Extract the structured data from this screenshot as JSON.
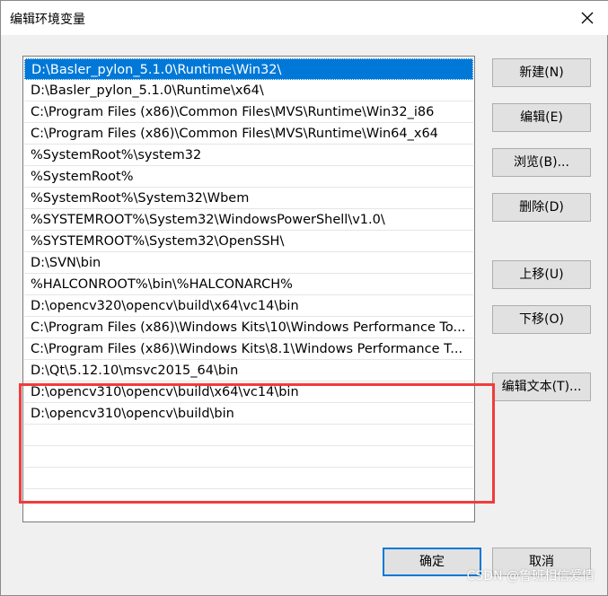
{
  "window": {
    "title": "编辑环境变量",
    "close_icon": "close-icon"
  },
  "list": {
    "items": [
      {
        "text": "D:\\Basler_pylon_5.1.0\\Runtime\\Win32\\",
        "selected": true
      },
      {
        "text": "D:\\Basler_pylon_5.1.0\\Runtime\\x64\\"
      },
      {
        "text": "C:\\Program Files (x86)\\Common Files\\MVS\\Runtime\\Win32_i86"
      },
      {
        "text": "C:\\Program Files (x86)\\Common Files\\MVS\\Runtime\\Win64_x64"
      },
      {
        "text": "%SystemRoot%\\system32"
      },
      {
        "text": "%SystemRoot%"
      },
      {
        "text": "%SystemRoot%\\System32\\Wbem"
      },
      {
        "text": "%SYSTEMROOT%\\System32\\WindowsPowerShell\\v1.0\\"
      },
      {
        "text": "%SYSTEMROOT%\\System32\\OpenSSH\\"
      },
      {
        "text": "D:\\SVN\\bin"
      },
      {
        "text": "%HALCONROOT%\\bin\\%HALCONARCH%"
      },
      {
        "text": "D:\\opencv320\\opencv\\build\\x64\\vc14\\bin"
      },
      {
        "text": "C:\\Program Files (x86)\\Windows Kits\\10\\Windows Performance To..."
      },
      {
        "text": "C:\\Program Files (x86)\\Windows Kits\\8.1\\Windows Performance T..."
      },
      {
        "text": "D:\\Qt\\5.12.10\\msvc2015_64\\bin"
      },
      {
        "text": "D:\\opencv310\\opencv\\build\\x64\\vc14\\bin"
      },
      {
        "text": "D:\\opencv310\\opencv\\build\\bin"
      },
      {
        "text": ""
      },
      {
        "text": ""
      },
      {
        "text": ""
      }
    ]
  },
  "buttons": {
    "new": "新建(N)",
    "edit": "编辑(E)",
    "browse": "浏览(B)...",
    "delete": "删除(D)",
    "move_up": "上移(U)",
    "move_down": "下移(O)",
    "edit_text": "编辑文本(T)...",
    "ok": "确定",
    "cancel": "取消"
  },
  "watermark": "CSDN @鲁班相信爱情",
  "colors": {
    "selection": "#0078d7",
    "highlight_box": "#f03c3c"
  }
}
